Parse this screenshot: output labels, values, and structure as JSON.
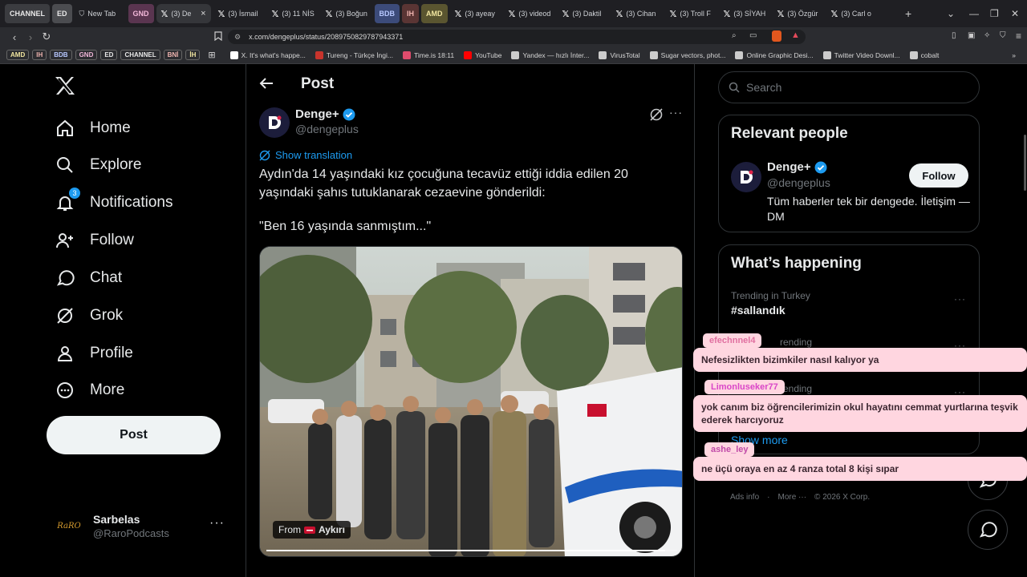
{
  "browser": {
    "tabs": [
      {
        "label": "CHANNEL",
        "kind": "pill",
        "bg": "#3b3c40",
        "fg": "#e8e8e8"
      },
      {
        "label": "ED",
        "kind": "pill",
        "bg": "#4b4c50",
        "fg": "#e8e8e8"
      },
      {
        "label": "New Tab",
        "kind": "plain",
        "icon": "shield"
      },
      {
        "label": "GND",
        "kind": "pill",
        "bg": "#5a3550",
        "fg": "#f2b7d9"
      },
      {
        "label": "(3) De",
        "kind": "active",
        "icon": "x"
      },
      {
        "label": "(3) İsmail",
        "kind": "plain",
        "icon": "x"
      },
      {
        "label": "(3) 11 NİS",
        "kind": "plain",
        "icon": "x"
      },
      {
        "label": "(3) Boğun",
        "kind": "plain",
        "icon": "x"
      },
      {
        "label": "BDB",
        "kind": "pill",
        "bg": "#3c4b7a",
        "fg": "#b8c8ff"
      },
      {
        "label": "IH",
        "kind": "pill",
        "bg": "#5a3534",
        "fg": "#f0b5b0"
      },
      {
        "label": "AMD",
        "kind": "pill",
        "bg": "#5a5530",
        "fg": "#f2e6a0"
      },
      {
        "label": "(3) ayeay",
        "kind": "plain",
        "icon": "x"
      },
      {
        "label": "(3) videod",
        "kind": "plain",
        "icon": "x"
      },
      {
        "label": "(3) Daktil",
        "kind": "plain",
        "icon": "x"
      },
      {
        "label": "(3) Cihan",
        "kind": "plain",
        "icon": "x"
      },
      {
        "label": "(3) Troll F",
        "kind": "plain",
        "icon": "x"
      },
      {
        "label": "(3) SİYAH",
        "kind": "plain",
        "icon": "x"
      },
      {
        "label": "(3) Özgür",
        "kind": "plain",
        "icon": "x"
      },
      {
        "label": "(3) Carl o",
        "kind": "plain",
        "icon": "x"
      }
    ],
    "url": "x.com/dengeplus/status/2089750829787943371",
    "bookmarks_pills": [
      {
        "label": "AMD",
        "fg": "#f2e6a0"
      },
      {
        "label": "IH",
        "fg": "#f0b5b0"
      },
      {
        "label": "BDB",
        "fg": "#b8c8ff"
      },
      {
        "label": "GND",
        "fg": "#f2b7d9"
      },
      {
        "label": "ED",
        "fg": "#e8e8e8"
      },
      {
        "label": "CHANNEL",
        "fg": "#e8e8e8"
      },
      {
        "label": "BNİ",
        "fg": "#f0b5b0"
      },
      {
        "label": "İH",
        "fg": "#f2e6a0"
      }
    ],
    "bookmarks": [
      {
        "label": "X. It's what's happe...",
        "color": "#ffffff"
      },
      {
        "label": "Tureng - Türkçe İngi...",
        "color": "#c8342c"
      },
      {
        "label": "Time.is 18:11",
        "color": "#e04c6d"
      },
      {
        "label": "YouTube",
        "color": "#ff0000"
      },
      {
        "label": "Yandex — hızlı İnter...",
        "color": "#cccccc"
      },
      {
        "label": "VirusTotal",
        "color": "#cccccc"
      },
      {
        "label": "Sugar vectors, phot...",
        "color": "#cccccc"
      },
      {
        "label": "Online Graphic Desi...",
        "color": "#cccccc"
      },
      {
        "label": "Twitter Video Downl...",
        "color": "#cccccc"
      },
      {
        "label": "cobalt",
        "color": "#cccccc"
      }
    ]
  },
  "nav": {
    "items": [
      {
        "label": "Home",
        "icon": "home-icon"
      },
      {
        "label": "Explore",
        "icon": "search-icon"
      },
      {
        "label": "Notifications",
        "icon": "bell-icon",
        "badge": "3"
      },
      {
        "label": "Follow",
        "icon": "follow-icon"
      },
      {
        "label": "Chat",
        "icon": "chat-icon"
      },
      {
        "label": "Grok",
        "icon": "grok-icon"
      },
      {
        "label": "Profile",
        "icon": "profile-icon"
      },
      {
        "label": "More",
        "icon": "more-icon"
      }
    ],
    "post_button": "Post",
    "account": {
      "display_name": "Sarbelas",
      "handle": "@RaroPodcasts",
      "avatar_text": "RaRO"
    }
  },
  "post": {
    "header_title": "Post",
    "author_name": "Denge+",
    "author_handle": "@dengeplus",
    "show_translation": "Show translation",
    "text": "Aydın'da 14 yaşındaki kız çocuğuna tecavüz ettiği iddia edilen 20 yaşındaki şahıs tutuklanarak cezaevine gönderildi:",
    "quote": "\"Ben 16 yaşında sanmıştım...\"",
    "media_source_prefix": "From",
    "media_source_name": "Aykırı",
    "media_progress": 0.97
  },
  "search": {
    "placeholder": "Search"
  },
  "relevant_people": {
    "title": "Relevant people",
    "name": "Denge+",
    "handle": "@dengeplus",
    "bio": "Tüm haberler tek bir dengede. İletişim — DM",
    "follow_label": "Follow"
  },
  "trends": {
    "title": "What’s happening",
    "items": [
      {
        "meta": "Trending in Turkey",
        "tag": "#sallandık"
      },
      {
        "meta": "rending",
        "tag": ""
      },
      {
        "meta": "rending",
        "tag": ""
      }
    ],
    "show_more": "Show more"
  },
  "footer": {
    "links": [
      "Ads info",
      "·",
      "More ···",
      "© 2026 X Corp."
    ]
  },
  "chat": [
    {
      "user": "efechnnel4",
      "user_color": "#e070a0",
      "message": "Nefesizlikten bizimkiler nasıl kalıyor ya"
    },
    {
      "user": "Limonluseker77",
      "user_color": "#d946c8",
      "message": "yok canım biz öğrencilerimizin okul hayatını cemmat yurtlarına teşvik ederek harcıyoruz"
    },
    {
      "user": "ashe_ley",
      "user_color": "#c04aa8",
      "message": "ne üçü oraya en az 4 ranza total 8 kişi sıpar"
    }
  ]
}
